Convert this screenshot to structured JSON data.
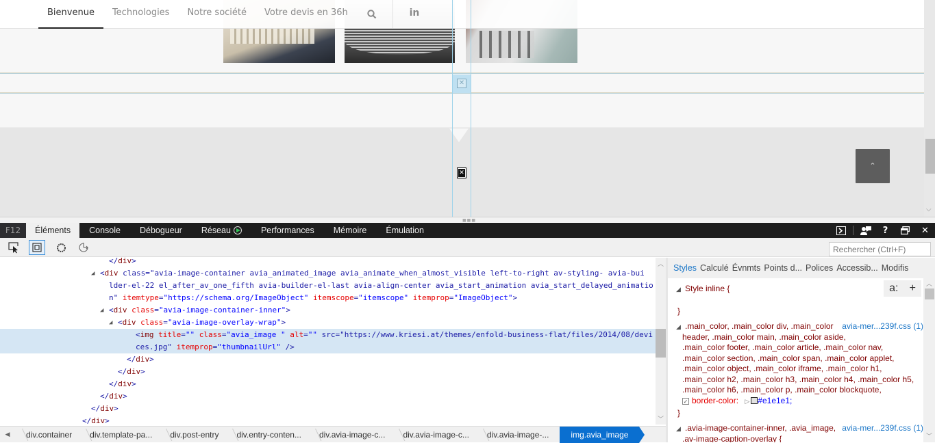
{
  "site": {
    "nav": [
      {
        "label": "Bienvenue",
        "active": true
      },
      {
        "label": "Technologies",
        "active": false
      },
      {
        "label": "Notre société",
        "active": false
      },
      {
        "label": "Votre devis en 36h",
        "active": false
      }
    ],
    "search_icon": "search-icon",
    "social_label": "in",
    "scroll_top_glyph": "⌃",
    "photos": [
      "3d-printed-part",
      "threaded-cylinder",
      "machine-assembly"
    ]
  },
  "devtools": {
    "f12_label": "F12",
    "tabs": [
      {
        "label": "Éléments",
        "active": true
      },
      {
        "label": "Console",
        "active": false
      },
      {
        "label": "Débogueur",
        "active": false
      },
      {
        "label": "Réseau",
        "active": false
      },
      {
        "label": "Performances",
        "active": false
      },
      {
        "label": "Mémoire",
        "active": false
      },
      {
        "label": "Émulation",
        "active": false
      }
    ],
    "right_icons": {
      "console": "⊳",
      "feedback": "feedback-icon",
      "help": "?",
      "undock": "undock-icon",
      "close": "✕"
    },
    "search_placeholder": "Rechercher (Ctrl+F)",
    "dom_lines": [
      {
        "indent": 12,
        "text": "</div>"
      },
      {
        "indent": 11,
        "text": "<div class=\"avia-image-container avia_animated_image avia_animate_when_almost_visible left-to-right av-styling- avia-bui"
      },
      {
        "indent": 0,
        "text": "lder-el-22 el_after_av_one_fifth avia-builder-el-last avia-align-center avia_start_animation avia_start_delayed_animatio"
      },
      {
        "indent": 0,
        "text": "n\" itemtype=\"https://schema.org/ImageObject\" itemscope=\"itemscope\" itemprop=\"ImageObject\">"
      },
      {
        "indent": 12,
        "text": "<div class=\"avia-image-container-inner\">"
      },
      {
        "indent": 13,
        "text": "<div class=\"avia-image-overlay-wrap\">"
      },
      {
        "indent": 15,
        "text": "<img title=\"\" class=\"avia_image \" alt=\"\" src=\"https://www.kriesi.at/themes/enfold-business-flat/files/2014/08/devi"
      },
      {
        "indent": 0,
        "text": "ces.jpg\" itemprop=\"thumbnailUrl\" />"
      },
      {
        "indent": 14,
        "text": "</div>"
      },
      {
        "indent": 13,
        "text": "</div>"
      },
      {
        "indent": 12,
        "text": "</div>"
      },
      {
        "indent": 11,
        "text": "</div>"
      },
      {
        "indent": 10,
        "text": "</div>"
      },
      {
        "indent": 9,
        "text": "</div>"
      }
    ],
    "breadcrumb": [
      {
        "label": "div.container"
      },
      {
        "label": "div.template-pa..."
      },
      {
        "label": "div.post-entry"
      },
      {
        "label": "div.entry-conten..."
      },
      {
        "label": "div.avia-image-c..."
      },
      {
        "label": "div.avia-image-c..."
      },
      {
        "label": "div.avia-image-..."
      },
      {
        "label": "img.avia_image",
        "active": true
      }
    ],
    "style_tabs": [
      {
        "label": "Styles",
        "active": true
      },
      {
        "label": "Calculé"
      },
      {
        "label": "Évnmts"
      },
      {
        "label": "Points d..."
      },
      {
        "label": "Polices"
      },
      {
        "label": "Accessib..."
      },
      {
        "label": "Modifis"
      }
    ],
    "styles": {
      "inline_label": "Style inline  {",
      "close_brace": "}",
      "action_a": "a:",
      "action_add": "+",
      "rule1": {
        "selector_lines": [
          ".main_color, .main_color div, .main_color",
          "header, .main_color main, .main_color aside,",
          ".main_color footer, .main_color article, .main_color nav,",
          ".main_color section, .main_color span, .main_color applet,",
          ".main_color object, .main_color iframe, .main_color h1,",
          ".main_color h2, .main_color h3, .main_color h4, .main_color h5,",
          ".main_color h6, .main_color p, .main_color blockquote,"
        ],
        "source": "avia-mer...239f.css (1)",
        "property": "border-color:",
        "value": "#e1e1e1;",
        "swatch_color": "#e1e1e1"
      },
      "rule2": {
        "selector_lines": [
          ".avia-image-container-inner, .avia_image,",
          ".av-image-caption-overlay  {"
        ],
        "source": "avia-mer...239f.css (1)"
      }
    }
  }
}
